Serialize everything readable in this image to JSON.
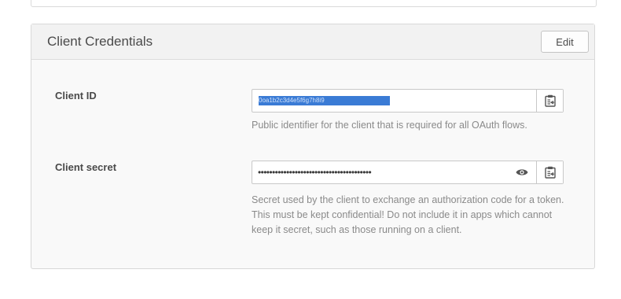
{
  "panel": {
    "title": "Client Credentials",
    "edit_label": "Edit"
  },
  "client_id": {
    "label": "Client ID",
    "value": "0oa1b2c3d4e5f6g7h8i9",
    "help": "Public identifier for the client that is required for all OAuth flows."
  },
  "client_secret": {
    "label": "Client secret",
    "value": "••••••••••••••••••••••••••••••••••••••••",
    "help": "Secret used by the client to exchange an authorization code for a token. This must be kept confidential! Do not include it in apps which cannot keep it secret, such as those running on a client."
  },
  "icons": {
    "copy": "clipboard-icon",
    "reveal": "eye-icon"
  },
  "colors": {
    "selection": "#3a7bd5",
    "help_text": "#8a8a8a"
  }
}
